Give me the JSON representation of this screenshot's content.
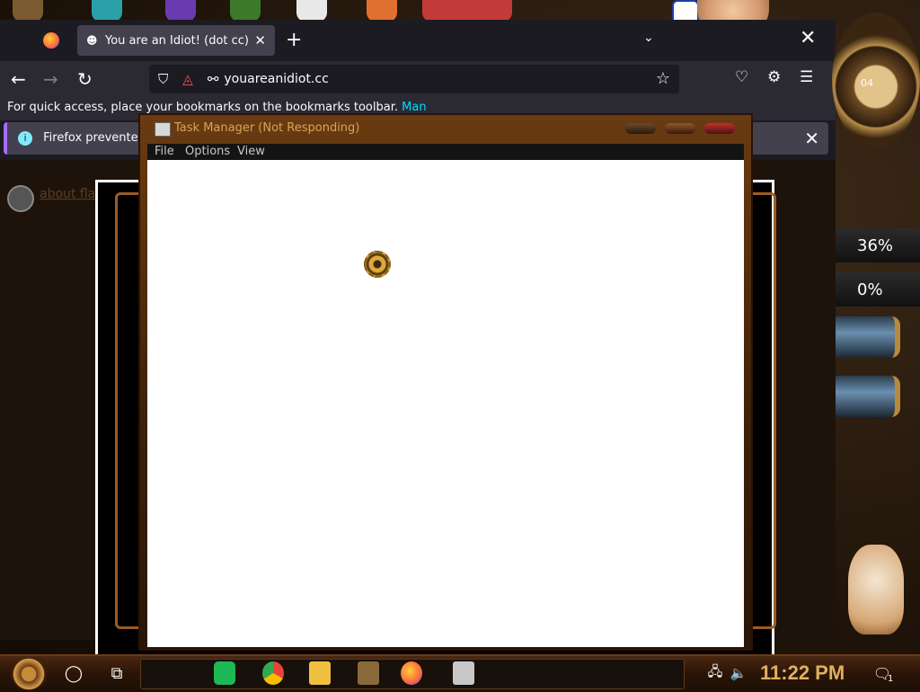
{
  "browser": {
    "tab_title": "You are an Idiot! (dot cc)",
    "tab_close": "✕",
    "new_tab": "+",
    "tab_list": "⌄",
    "window_close": "✕",
    "url": "youareanidiot.cc",
    "bookmarks_text": "For quick access, place your bookmarks on the bookmarks toolbar.",
    "bookmarks_link": "Man",
    "notice_text": "Firefox prevented this page from",
    "notice_close": "✕",
    "flash_link": "about flash",
    "back": "←",
    "forward": "→",
    "reload": "↻",
    "star": "☆",
    "menu": "☰",
    "pocket": "♡",
    "extensions": "⚙"
  },
  "task_manager": {
    "title": "Task Manager (Not Responding)",
    "menu": [
      "File",
      "Options",
      "View"
    ]
  },
  "gadgets": {
    "clock_number": "04",
    "cpu_percent": "36%",
    "ram_percent": "0%"
  },
  "taskbar": {
    "time": "11:22 PM",
    "notification_count": "1"
  },
  "colors": {
    "firefox_bg": "#1c1b22",
    "firefox_toolbar": "#2b2a33",
    "accent_link": "#00ddff",
    "tm_title": "#d9a356"
  }
}
